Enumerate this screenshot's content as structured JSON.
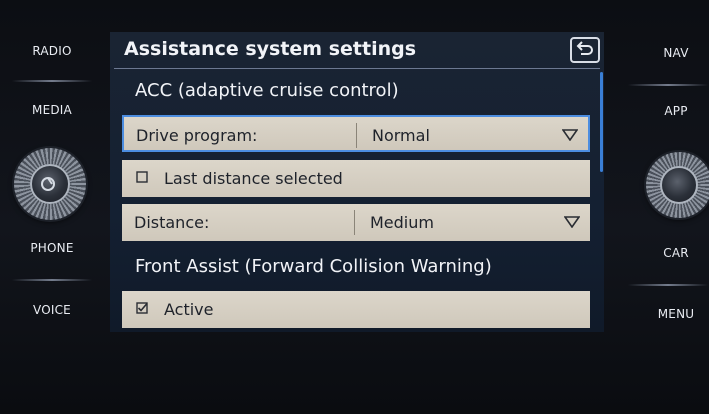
{
  "hardware": {
    "left_buttons": [
      "RADIO",
      "MEDIA",
      "PHONE",
      "VOICE"
    ],
    "right_buttons": [
      "NAV",
      "APP",
      "CAR",
      "MENU"
    ]
  },
  "screen": {
    "title": "Assistance system settings",
    "sections": {
      "acc_title": "ACC (adaptive cruise control)",
      "front_assist_title": "Front Assist (Forward Collision Warning)"
    },
    "rows": {
      "drive_program": {
        "label": "Drive program:",
        "value": "Normal"
      },
      "last_distance": {
        "label": "Last distance selected",
        "checked": false
      },
      "distance": {
        "label": "Distance:",
        "value": "Medium"
      },
      "active": {
        "label": "Active",
        "checked": true
      }
    }
  },
  "colors": {
    "accent": "#4c8de0",
    "row_background": "#d7d0c3",
    "screen_background": "#162133"
  },
  "icons": [
    "back-icon",
    "power-icon",
    "dropdown-triangle-icon",
    "checkbox-icon"
  ]
}
